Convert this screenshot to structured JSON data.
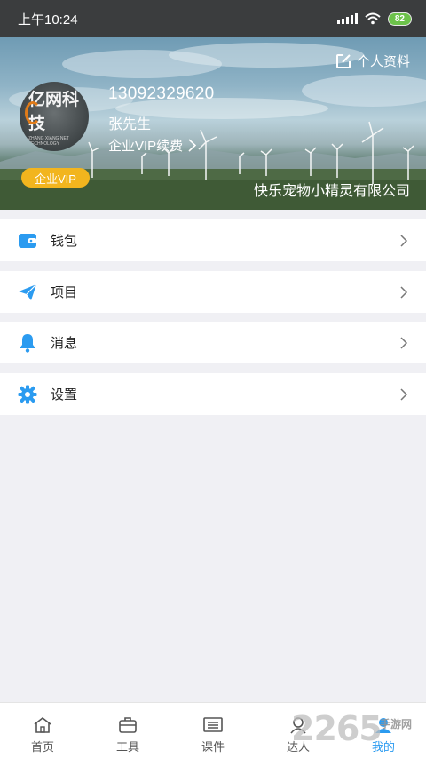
{
  "status_bar": {
    "time": "上午10:24",
    "battery": "82"
  },
  "header": {
    "edit_profile_label": "个人资料",
    "avatar_logo_text": "亿网科技",
    "avatar_logo_subtext": "ZHANG XIANG NET TECHNOLOGY",
    "vip_badge": "企业VIP",
    "phone": "13092329620",
    "username": "张先生",
    "renew_label": "企业VIP续费",
    "company": "快乐宠物小精灵有限公司"
  },
  "menu": {
    "items": [
      {
        "label": "钱包",
        "icon": "wallet-icon"
      },
      {
        "label": "项目",
        "icon": "paper-plane-icon"
      },
      {
        "label": "消息",
        "icon": "bell-icon"
      },
      {
        "label": "设置",
        "icon": "gear-icon"
      }
    ]
  },
  "bottom_nav": {
    "items": [
      {
        "label": "首页",
        "icon": "home-icon"
      },
      {
        "label": "工具",
        "icon": "briefcase-icon"
      },
      {
        "label": "课件",
        "icon": "courseware-icon"
      },
      {
        "label": "达人",
        "icon": "expert-icon"
      },
      {
        "label": "我的",
        "icon": "profile-icon"
      }
    ],
    "active": "我的"
  },
  "watermark": {
    "number": "2265",
    "site_text": "手游网"
  },
  "colors": {
    "accent": "#2b9bf0",
    "vip": "#f2b51e",
    "status_bar": "#3b3d3e",
    "page_background": "#f0f0f4"
  }
}
